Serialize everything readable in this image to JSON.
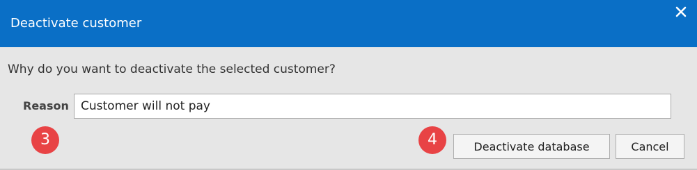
{
  "dialog": {
    "title": "Deactivate customer",
    "question": "Why do you want to deactivate the selected customer?",
    "reason_label": "Reason",
    "reason_value": "Customer will not pay",
    "deactivate_label": "Deactivate database",
    "cancel_label": "Cancel",
    "close_icon": "close-icon"
  },
  "annotations": {
    "step_3": "3",
    "step_4": "4"
  },
  "colors": {
    "titlebar": "#0a6fc6",
    "background": "#e6e6e6",
    "badge": "#e84345"
  }
}
